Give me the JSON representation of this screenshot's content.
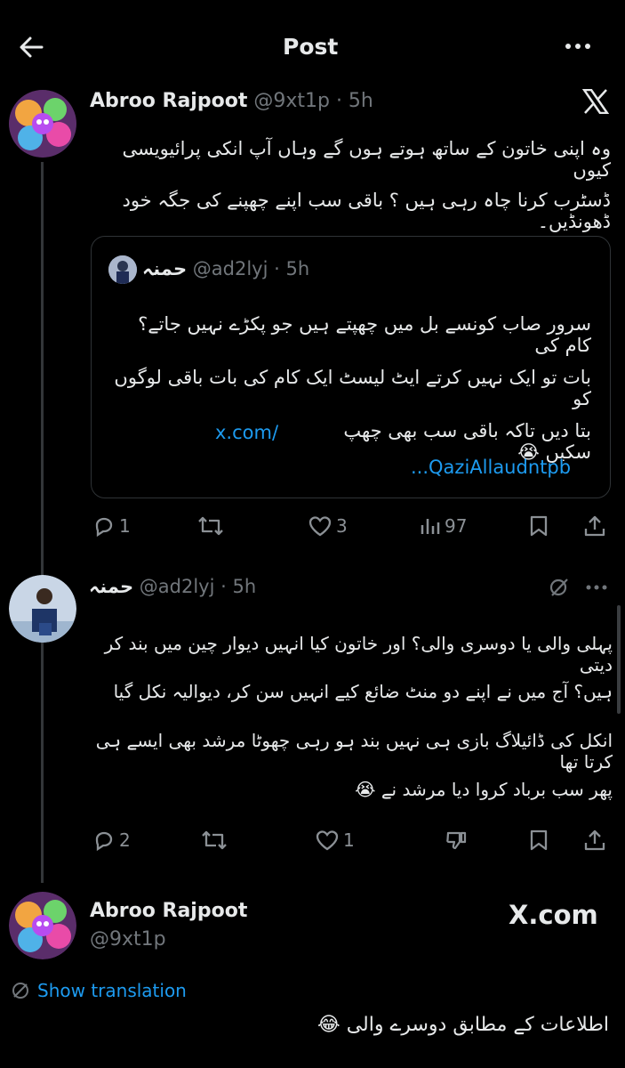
{
  "header": {
    "title": "Post"
  },
  "tweet1": {
    "name": "Abroo Rajpoot",
    "handle_time": "@9xt1p · 5h",
    "lines": [
      "وہ اپنی خاتون کے ساتھ ہوتے ہوں گے وہاں آپ انکی پرائیویسی کیوں",
      "ڈسٹرب کرنا چاہ رہی ہیں ؟ باقی سب اپنے چھپنے کی جگہ خود ڈھونڈیں۔"
    ],
    "quote": {
      "name": "حمنہ",
      "handle_time": "@ad2lyj · 5h",
      "lines": [
        "سرور صاب کونسے بل میں چھپتے ہیں جو پکڑے نہیں جاتے؟ کام کی",
        "بات تو ایک نہیں کرتے ایٹ لیسٹ ایک کام کی بات باقی لوگوں کو",
        "بتا دیں تاکہ باقی سب بھی چھپ سکیں 😭"
      ],
      "link_a": "x.com/",
      "link_b": "...QaziAllaudntpb"
    },
    "stats": {
      "replies": "1",
      "likes": "3",
      "views": "97"
    }
  },
  "tweet2": {
    "name": "حمنہ",
    "handle_time": "@ad2lyj · 5h",
    "lines": [
      "پہلی والی یا دوسری والی؟ اور خاتون کیا انہیں دیوار چین میں بند کر دیتی",
      "ہیں؟ آج میں نے اپنے دو منٹ ضائع کیے انہیں سن کر، دیوالیہ نکل گیا",
      "انکل کی ڈائیلاگ بازی ہی نہیں بند ہو رہی چھوٹا مرشد بھی ایسے ہی کرتا تھا",
      "پھر سب برباد کروا دیا مرشد نے 😭"
    ],
    "stats": {
      "replies": "2",
      "likes": "1"
    }
  },
  "tweet3": {
    "name": "Abroo Rajpoot",
    "handle": "@9xt1p",
    "watermark": "X.com",
    "translate_label": "Show translation",
    "text": "اطلاعات کے مطابق دوسرے والی 😂"
  },
  "colors": {
    "background": "#000000",
    "link": "#1d9bf0",
    "muted": "#71767b",
    "text": "#e7e9ea"
  },
  "icons": [
    "back-arrow-icon",
    "more-icon",
    "x-logo-icon",
    "reply-icon",
    "retweet-icon",
    "like-icon",
    "views-icon",
    "bookmark-icon",
    "share-icon",
    "grok-icon",
    "dislike-icon",
    "globe-icon"
  ]
}
